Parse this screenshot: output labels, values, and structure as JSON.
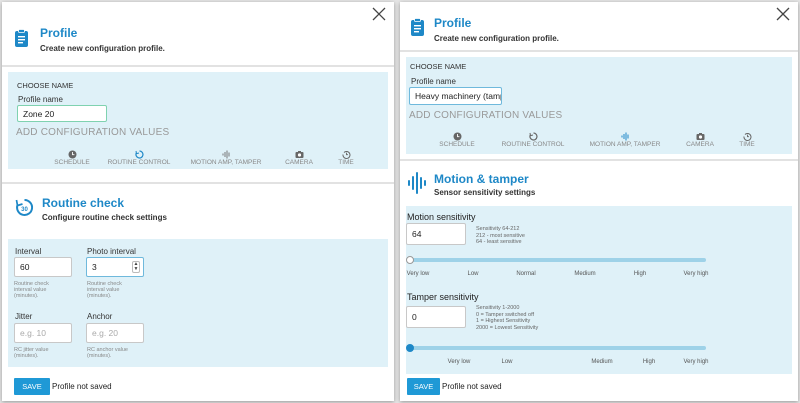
{
  "left": {
    "header": {
      "title": "Profile",
      "subtitle": "Create new configuration profile."
    },
    "choose_name": "CHOOSE NAME",
    "profile_name_label": "Profile name",
    "profile_name_value": "Zone 20",
    "add_config": "ADD CONFIGURATION VALUES",
    "tabs": [
      "SCHEDULE",
      "ROUTINE CONTROL",
      "MOTION AMP, TAMPER",
      "CAMERA",
      "TIME"
    ],
    "section": {
      "title": "Routine check",
      "subtitle": "Configure routine check settings"
    },
    "interval": {
      "label": "Interval",
      "value": "60",
      "help": "Routine check interval value (minutes)."
    },
    "photo_interval": {
      "label": "Photo interval",
      "value": "3",
      "help": "Routine check interval value (minutes)."
    },
    "jitter": {
      "label": "Jitter",
      "placeholder": "e.g. 10",
      "help": "RC jitter value (minutes)."
    },
    "anchor": {
      "label": "Anchor",
      "placeholder": "e.g. 20",
      "help": "RC anchor value (minutes)."
    },
    "save_label": "SAVE",
    "status": "Profile not saved"
  },
  "right": {
    "header": {
      "title": "Profile",
      "subtitle": "Create new configuration profile."
    },
    "choose_name": "CHOOSE NAME",
    "profile_name_label": "Profile name",
    "profile_name_value": "Heavy machinery (tampe",
    "add_config": "ADD CONFIGURATION VALUES",
    "tabs": [
      "SCHEDULE",
      "ROUTINE CONTROL",
      "MOTION AMP, TAMPER",
      "CAMERA",
      "TIME"
    ],
    "section": {
      "title": "Motion & tamper",
      "subtitle": "Sensor sensitivity settings"
    },
    "motion": {
      "label": "Motion sensitivity",
      "value": "64",
      "help": [
        "Sensitivity 64-212",
        "212 - most sensitive",
        "64 - least sensitive"
      ],
      "ticks": [
        "Very low",
        "Low",
        "Normal",
        "Medium",
        "High",
        "Very high"
      ],
      "level": 0
    },
    "tamper": {
      "label": "Tamper sensitivity",
      "value": "0",
      "help": [
        "Sensitivity 1-2000",
        "0 = Tamper switched off",
        "1 = Highest Sensitivity",
        "2000 = Lowest Sensitivity"
      ],
      "ticks": [
        "Very low",
        "Low",
        "Medium",
        "High",
        "Very high"
      ],
      "level": 0
    },
    "save_label": "SAVE",
    "status": "Profile not saved"
  },
  "colors": {
    "accent": "#1e88c7",
    "band": "#dff1f8",
    "save": "#1f99d6",
    "track": "#9ed2e8"
  },
  "icons": {
    "profile": "clipboard-icon",
    "routine": "timer-30-icon",
    "motion": "sound-wave-icon",
    "close": "close-icon"
  }
}
